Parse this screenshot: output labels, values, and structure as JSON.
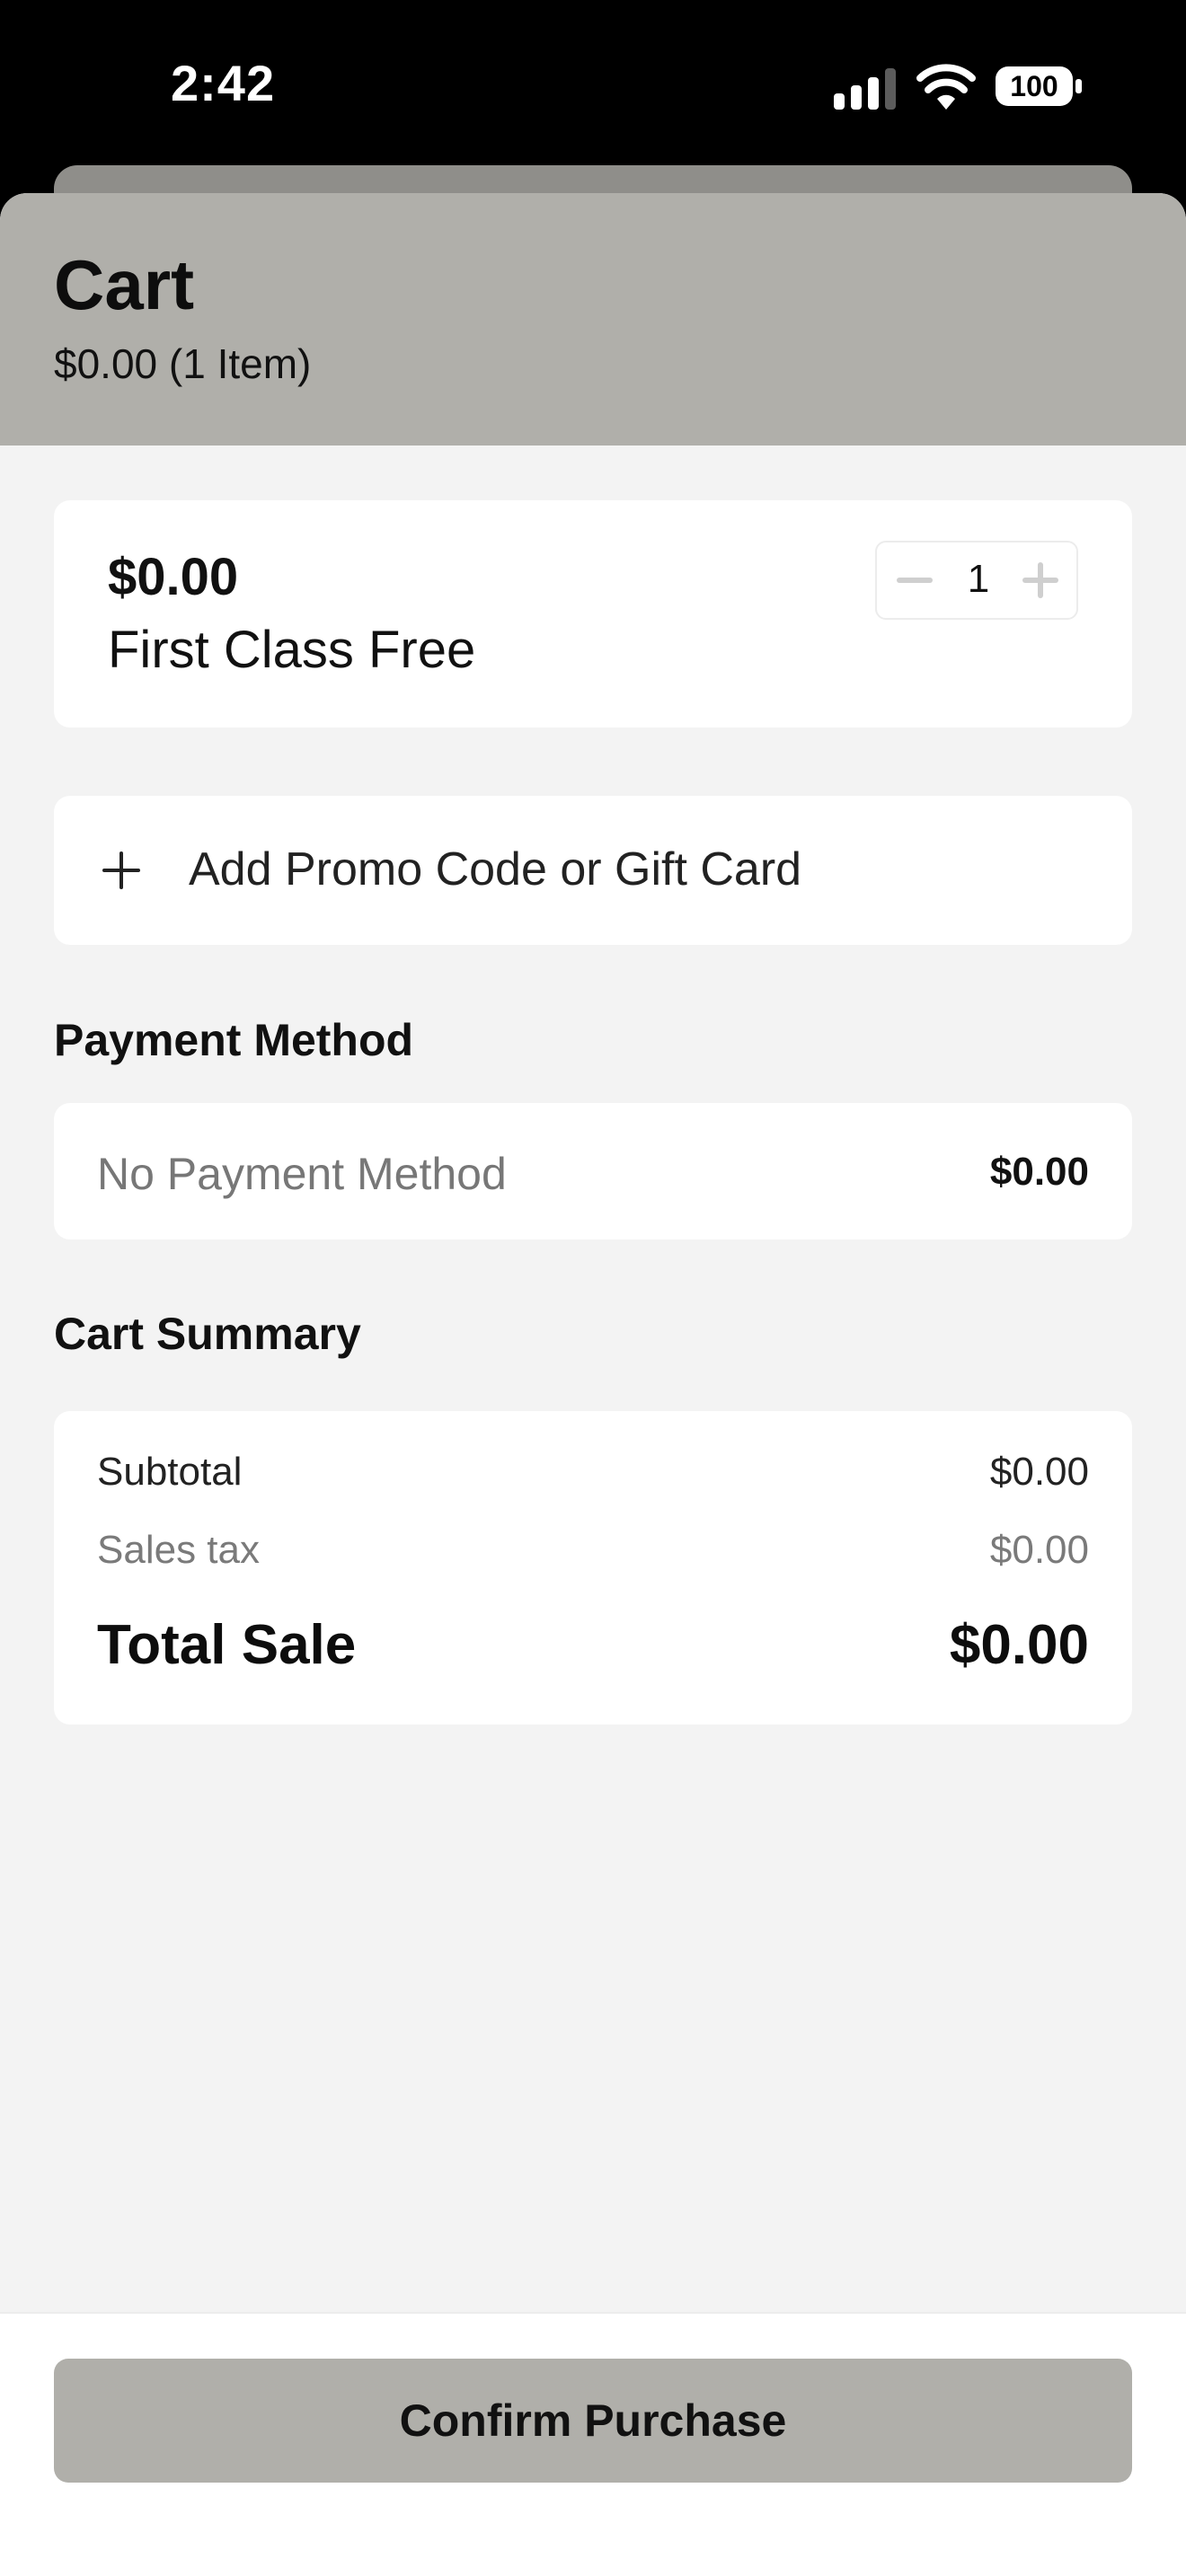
{
  "status_bar": {
    "time": "2:42",
    "battery": "100",
    "icons": [
      "signal-icon",
      "wifi-icon",
      "battery-icon"
    ]
  },
  "header": {
    "title": "Cart",
    "subtitle": "$0.00 (1 Item)"
  },
  "item": {
    "price": "$0.00",
    "name": "First Class Free",
    "quantity": "1"
  },
  "promo": {
    "label": "Add Promo Code or Gift Card"
  },
  "payment": {
    "section_title": "Payment Method",
    "method": "No Payment Method",
    "amount": "$0.00"
  },
  "summary": {
    "section_title": "Cart Summary",
    "subtotal_label": "Subtotal",
    "subtotal_value": "$0.00",
    "tax_label": "Sales tax",
    "tax_value": "$0.00",
    "total_label": "Total Sale",
    "total_value": "$0.00"
  },
  "footer": {
    "confirm_label": "Confirm Purchase"
  },
  "colors": {
    "header_bg": "#b0afaa",
    "page_bg": "#f3f3f3",
    "button_bg": "#b0afaa"
  }
}
